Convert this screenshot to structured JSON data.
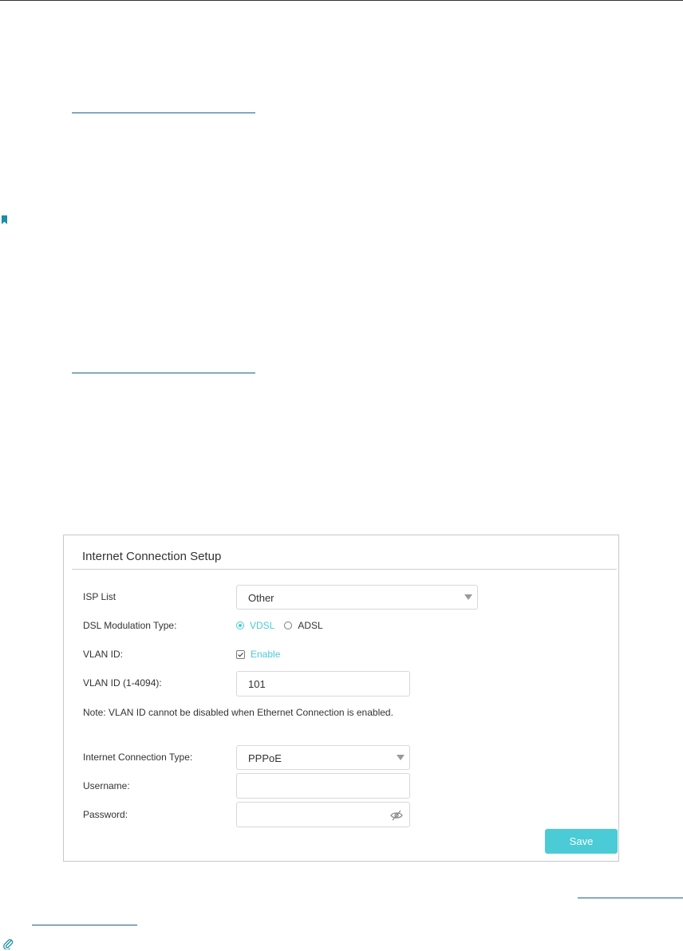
{
  "panel": {
    "title": "Internet Connection Setup",
    "isp_list": {
      "label": "ISP List",
      "value": "Other"
    },
    "dsl_modulation": {
      "label": "DSL Modulation Type:",
      "options": [
        "VDSL",
        "ADSL"
      ],
      "selected": "VDSL"
    },
    "vlan": {
      "label": "VLAN ID:",
      "enable_label": "Enable",
      "checked": true
    },
    "vlan_id": {
      "label": "VLAN ID (1-4094):",
      "value": "101"
    },
    "note": "Note: VLAN ID cannot be disabled when Ethernet Connection is enabled.",
    "connection_type": {
      "label": "Internet Connection Type:",
      "value": "PPPoE"
    },
    "username": {
      "label": "Username:",
      "value": ""
    },
    "password": {
      "label": "Password:",
      "value": ""
    },
    "save_label": "Save"
  },
  "colors": {
    "accent": "#4acbd6",
    "link_rule": "#1a5f8a"
  },
  "icons": [
    "bookmark-icon",
    "paperclip-icon",
    "chevron-down-icon",
    "eye-slash-icon",
    "check-icon"
  ]
}
